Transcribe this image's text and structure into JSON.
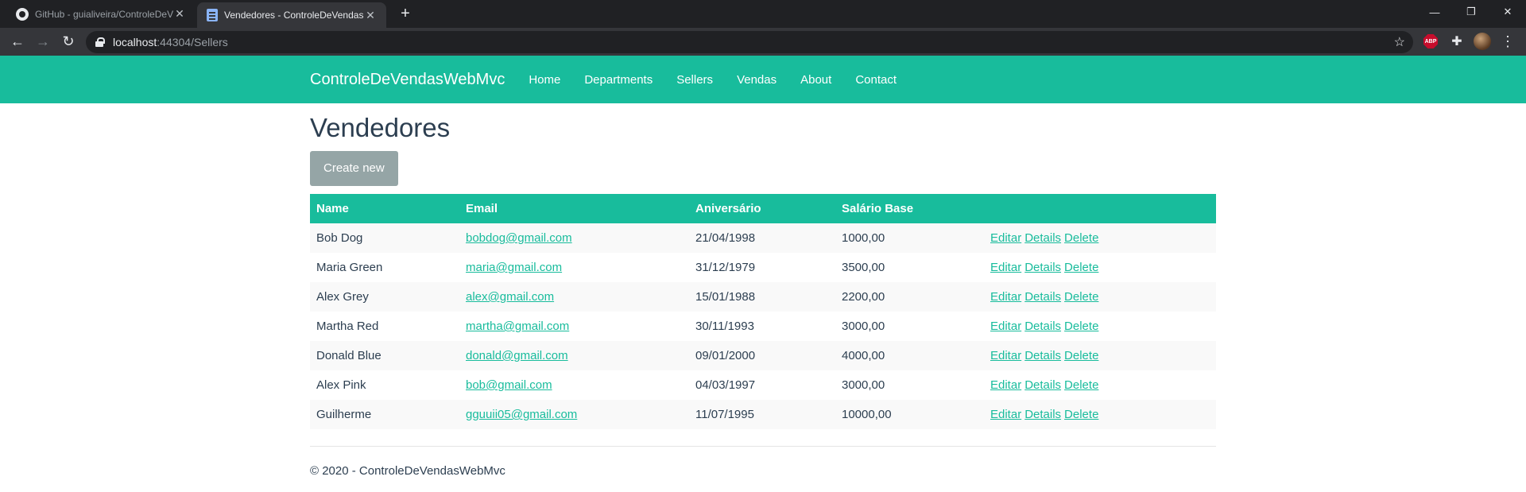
{
  "browser": {
    "tabs": [
      {
        "title": "GitHub - guialiveira/ControleDeV",
        "icon": "github-icon"
      },
      {
        "title": "Vendedores - ControleDeVendas",
        "icon": "document-icon"
      }
    ],
    "address": {
      "host": "localhost",
      "rest": ":44304/Sellers"
    },
    "extensions": {
      "abp_label": "ABP"
    }
  },
  "navbar": {
    "brand": "ControleDeVendasWebMvc",
    "links": [
      "Home",
      "Departments",
      "Sellers",
      "Vendas",
      "About",
      "Contact"
    ]
  },
  "page": {
    "title": "Vendedores",
    "create_label": "Create new"
  },
  "table": {
    "headers": [
      "Name",
      "Email",
      "Aniversário",
      "Salário Base",
      ""
    ],
    "actions": [
      "Editar",
      "Details",
      "Delete"
    ],
    "rows": [
      {
        "name": "Bob Dog",
        "email": "bobdog@gmail.com",
        "birth": "21/04/1998",
        "salary": "1000,00"
      },
      {
        "name": "Maria Green",
        "email": "maria@gmail.com",
        "birth": "31/12/1979",
        "salary": "3500,00"
      },
      {
        "name": "Alex Grey",
        "email": "alex@gmail.com",
        "birth": "15/01/1988",
        "salary": "2200,00"
      },
      {
        "name": "Martha Red",
        "email": "martha@gmail.com",
        "birth": "30/11/1993",
        "salary": "3000,00"
      },
      {
        "name": "Donald Blue",
        "email": "donald@gmail.com",
        "birth": "09/01/2000",
        "salary": "4000,00"
      },
      {
        "name": "Alex Pink",
        "email": "bob@gmail.com",
        "birth": "04/03/1997",
        "salary": "3000,00"
      },
      {
        "name": "Guilherme",
        "email": "gguuii05@gmail.com",
        "birth": "11/07/1995",
        "salary": "10000,00"
      }
    ]
  },
  "footer": {
    "text": "© 2020 - ControleDeVendasWebMvc"
  },
  "colors": {
    "accent": "#18bc9c",
    "primary_text": "#2c3e50",
    "secondary_button": "#95a5a6"
  }
}
